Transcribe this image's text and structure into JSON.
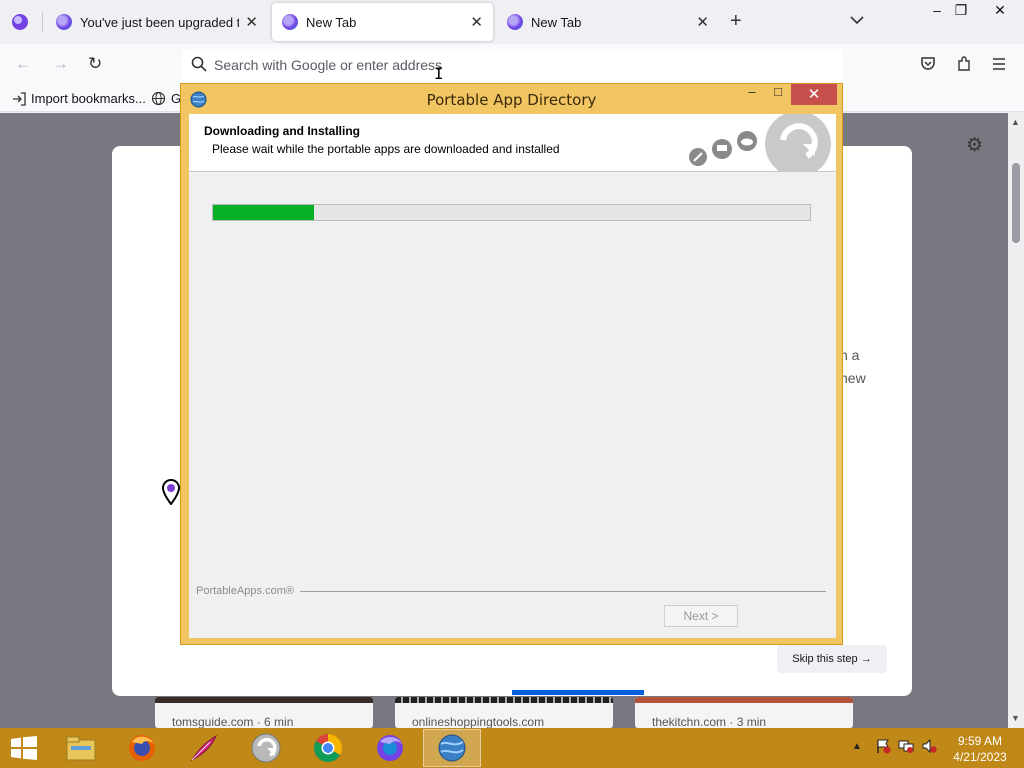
{
  "browser": {
    "tabs": [
      {
        "label": "You've just been upgraded to Firefox",
        "active": false
      },
      {
        "label": "New Tab",
        "active": true
      },
      {
        "label": "New Tab",
        "active": false
      }
    ],
    "new_tab_symbol": "+",
    "list_all_tabs_symbol": "⌄",
    "window_controls": {
      "minimize": "–",
      "restore": "❐",
      "close": "✕"
    },
    "nav": {
      "back": "←",
      "forward": "→",
      "reload": "↻"
    },
    "address_placeholder": "Search with Google or enter address",
    "toolbar_icons": [
      "pocket-icon",
      "extensions-icon",
      "menu-icon"
    ],
    "bookmarks": [
      {
        "label": "Import bookmarks...",
        "icon": "import-icon"
      },
      {
        "label": "G",
        "icon": "globe-icon"
      }
    ]
  },
  "page": {
    "card_text_fragments": [
      "h a",
      "new"
    ],
    "skip_button": "Skip this step →",
    "stories": [
      {
        "source": "tomsguide.com · 6 min"
      },
      {
        "source": "onlineshoppingtools.com"
      },
      {
        "source": "thekitchn.com · 3 min"
      }
    ]
  },
  "dialog": {
    "title": "Portable App Directory",
    "controls": {
      "minimize": "–",
      "maximize": "□",
      "close": "✕"
    },
    "heading": "Downloading and Installing",
    "subheading": "Please wait while the portable apps are downloaded and installed",
    "progress": 0.17,
    "brand": "PortableApps.com®",
    "next_button": "Next >",
    "accent_color": "#f2c563",
    "progress_color": "#06b025"
  },
  "taskbar": {
    "apps": [
      "windows-explorer-icon",
      "firefox-icon",
      "feather-icon",
      "portableapps-icon",
      "chrome-icon",
      "firefox-nightly-icon",
      "portable-app-directory-icon"
    ],
    "tray": {
      "show_hidden": "▲"
    },
    "clock": {
      "time": "9:59 AM",
      "date": "4/21/2023"
    },
    "color": "#c08816"
  }
}
